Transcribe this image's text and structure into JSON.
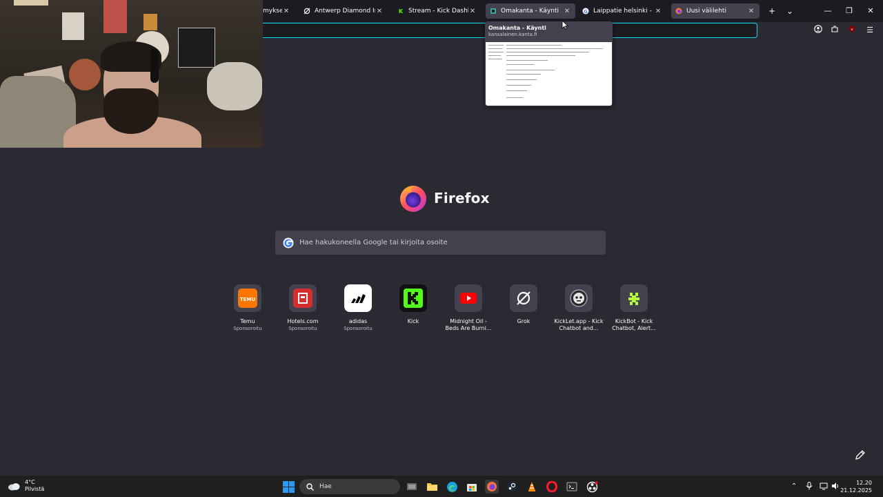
{
  "browser": {
    "tabs": [
      {
        "title": "mykset hi",
        "favicon": "generic-icon",
        "active": false
      },
      {
        "title": "Antwerp Diamond Industry",
        "favicon": "grok-icon",
        "active": false
      },
      {
        "title": "Stream - Kick Dashboard",
        "favicon": "kick-icon",
        "active": false
      },
      {
        "title": "Omakanta - Käynti",
        "favicon": "kanta-icon",
        "active": true
      },
      {
        "title": "Laippatie helsinki - Google",
        "favicon": "google-icon",
        "active": false
      },
      {
        "title": "Uusi välilehti",
        "favicon": "firefox-icon",
        "active": true
      }
    ],
    "tab_preview": {
      "title": "Omakanta - Käynti",
      "url": "kansalainen.kanta.fi"
    }
  },
  "newtab": {
    "brand": "Firefox",
    "search_placeholder": "Hae hakukoneella Google tai kirjoita osoite",
    "shortcuts": [
      {
        "name": "Temu",
        "sponsored": "Sponsoroitu",
        "icon": "temu-icon",
        "color": "#fb7701"
      },
      {
        "name": "Hotels.com",
        "sponsored": "Sponsoroitu",
        "icon": "hotels-icon",
        "color": "#d32f2f"
      },
      {
        "name": "adidas",
        "sponsored": "Sponsoroitu",
        "icon": "adidas-icon",
        "color": "#ffffff"
      },
      {
        "name": "Kick",
        "sponsored": "",
        "icon": "kick-icon",
        "color": "#53fc18"
      },
      {
        "name": "Midnight Oil -\nBeds Are Burni...",
        "sponsored": "",
        "icon": "youtube-icon",
        "color": "#ff0000"
      },
      {
        "name": "Grok",
        "sponsored": "",
        "icon": "grok-icon",
        "color": "#ffffff"
      },
      {
        "name": "KickLet.app - Kick\nChatbot and...",
        "sponsored": "",
        "icon": "kicklet-icon",
        "color": "#9aa0a6"
      },
      {
        "name": "KickBot - Kick\nChatbot, Alert...",
        "sponsored": "",
        "icon": "kickbot-icon",
        "color": "#b6f83a"
      }
    ]
  },
  "taskbar": {
    "weather_temp": "4°C",
    "weather_desc": "Pilvistä",
    "search_label": "Hae",
    "time": "12.20",
    "date": "21.12.2025"
  },
  "colors": {
    "background": "#2b2a33",
    "accent": "#00ddff"
  }
}
